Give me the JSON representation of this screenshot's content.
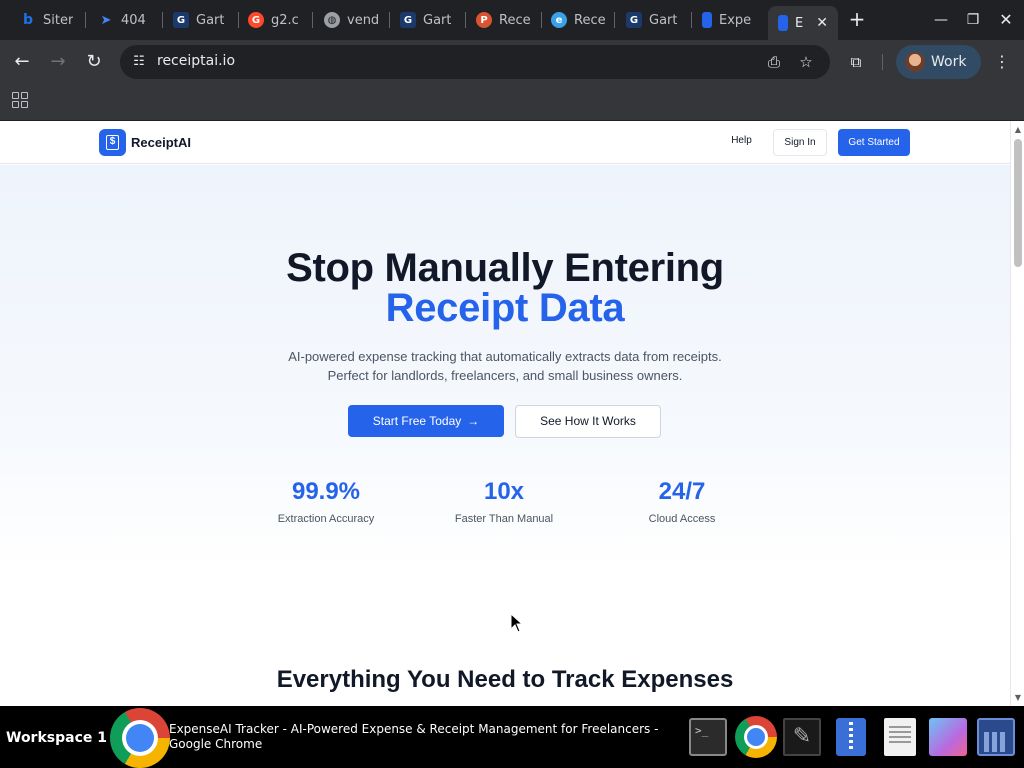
{
  "browser": {
    "tabs": [
      {
        "title": "Siter",
        "favicon": "bing-icon",
        "color": "#1a73e8"
      },
      {
        "title": "404",
        "favicon": "send-icon",
        "color": "#4285f4"
      },
      {
        "title": "Gart",
        "favicon": "gartner-icon",
        "color": "#1b3a6b"
      },
      {
        "title": "g2.c",
        "favicon": "g2-icon",
        "color": "#ff492c"
      },
      {
        "title": "vend",
        "favicon": "globe-icon",
        "color": "#9aa0a6"
      },
      {
        "title": "Gart",
        "favicon": "gartner-icon",
        "color": "#1b3a6b"
      },
      {
        "title": "Rece",
        "favicon": "producthunt-icon",
        "color": "#da552f"
      },
      {
        "title": "Rece",
        "favicon": "edge-icon",
        "color": "#3aa0e8"
      },
      {
        "title": "Gart",
        "favicon": "gartner-icon",
        "color": "#1b3a6b"
      },
      {
        "title": "Expe",
        "favicon": "receipt-icon",
        "color": "#2563eb"
      },
      {
        "title": "E",
        "favicon": "receipt-icon",
        "color": "#2563eb",
        "active": true
      }
    ],
    "url": "receiptai.io",
    "profile_label": "Work"
  },
  "site": {
    "logo_text": "ReceiptAI",
    "nav": {
      "help": "Help",
      "sign_in": "Sign In",
      "get_started": "Get Started"
    },
    "hero": {
      "title_line1": "Stop Manually Entering",
      "title_line2": "Receipt Data",
      "subtitle_line1": "AI-powered expense tracking that automatically extracts data from receipts.",
      "subtitle_line2": "Perfect for landlords, freelancers, and small business owners.",
      "cta_primary": "Start Free Today",
      "cta_primary_arrow": "→",
      "cta_secondary": "See How It Works"
    },
    "stats": [
      {
        "value": "99.9%",
        "label": "Extraction Accuracy"
      },
      {
        "value": "10x",
        "label": "Faster Than Manual"
      },
      {
        "value": "24/7",
        "label": "Cloud Access"
      }
    ],
    "features_title": "Everything You Need to Track Expenses"
  },
  "taskbar": {
    "workspace": "Workspace 1",
    "window_title_line1": "ExpenseAI Tracker - AI-Powered Expense & Receipt Management for Freelancers -",
    "window_title_line2": "Google Chrome"
  },
  "colors": {
    "accent": "#2563eb",
    "text_dark": "#111827",
    "text_muted": "#4b5563"
  }
}
